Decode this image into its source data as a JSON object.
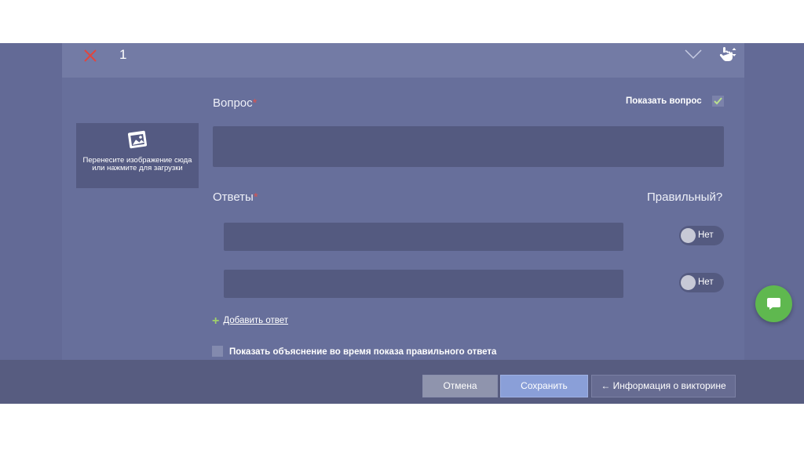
{
  "question": {
    "number": "1",
    "label": "Вопрос",
    "required_mark": "*",
    "show_question_label": "Показать вопрос",
    "show_question_checked": true,
    "input_value": ""
  },
  "image_drop": {
    "text": "Перенесите изображение сюда или нажмите для загрузки"
  },
  "answers": {
    "label": "Ответы",
    "required_mark": "*",
    "correct_label": "Правильный?",
    "items": [
      {
        "value": "",
        "toggle_label": "Нет",
        "correct": false
      },
      {
        "value": "",
        "toggle_label": "Нет",
        "correct": false
      }
    ],
    "add_label": "Добавить ответ"
  },
  "explanation": {
    "label": "Показать объяснение во время показа правильного ответа",
    "checked": false
  },
  "footer": {
    "cancel_label": "Отмена",
    "save_label": "Сохранить",
    "info_label": "Информация о викторине"
  },
  "icons": {
    "delete": "close-icon",
    "collapse": "chevron-down-icon",
    "drag": "drag-hand-icon",
    "image": "image-icon",
    "chat": "chat-icon",
    "back": "arrow-left-icon",
    "add": "plus-icon"
  },
  "colors": {
    "background": "#636a96",
    "card": "#676f9b",
    "header": "#737ba5",
    "input": "#545a80",
    "footer": "#575c80",
    "delete_icon": "#e0463f",
    "save_button": "#8a9fd8",
    "chat_button": "#5fb84f"
  }
}
